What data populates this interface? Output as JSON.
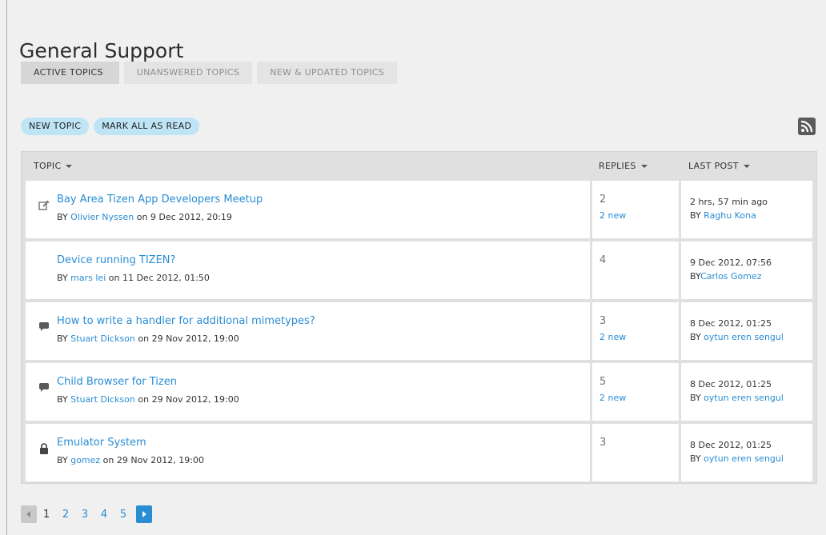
{
  "page": {
    "title": "General Support"
  },
  "tabs": [
    {
      "label": "ACTIVE TOPICS"
    },
    {
      "label": "UNANSWERED TOPICS"
    },
    {
      "label": "NEW & UPDATED TOPICS"
    }
  ],
  "actions": {
    "new_topic": "NEW TOPIC",
    "mark_all_read": "MARK ALL AS READ"
  },
  "table": {
    "headers": {
      "topic": "TOPIC",
      "replies": "REPLIES",
      "last_post": "LAST POST"
    },
    "rows": [
      {
        "icon": "edit-icon",
        "title": "Bay Area Tizen App Developers Meetup",
        "by": "BY ",
        "author": "Olivier Nyssen",
        "on": " on 9 Dec 2012,  20:19",
        "replies": "2",
        "new_replies": "2 new",
        "last_time": "2 hrs, 57 min ago",
        "last_by": "BY ",
        "last_author": "Raghu Kona"
      },
      {
        "icon": "",
        "title": "Device running TIZEN?",
        "by": "BY ",
        "author": "mars lei",
        "on": " on 11 Dec 2012,  01:50",
        "replies": "4",
        "new_replies": "",
        "last_time": "9 Dec 2012,  07:56",
        "last_by": "BY",
        "last_author": "Carlos Gomez"
      },
      {
        "icon": "chat-bubble-icon",
        "title": "How to write a handler for additional mimetypes?",
        "by": "BY ",
        "author": "Stuart Dickson",
        "on": " on 29 Nov 2012, 19:00",
        "replies": "3",
        "new_replies": "2 new",
        "last_time": "8 Dec 2012, 01:25",
        "last_by": "BY ",
        "last_author": "oytun eren sengul"
      },
      {
        "icon": "chat-bubble-icon",
        "title": "Child Browser for Tizen",
        "by": "BY ",
        "author": "Stuart Dickson",
        "on": " on 29 Nov 2012, 19:00",
        "replies": "5",
        "new_replies": "2 new",
        "last_time": "8 Dec 2012, 01:25",
        "last_by": "BY ",
        "last_author": "oytun eren sengul"
      },
      {
        "icon": "lock-icon",
        "title": "Emulator System",
        "by": "BY ",
        "author": "gomez",
        "on": " on 29 Nov 2012, 19:00",
        "replies": "3",
        "new_replies": "",
        "last_time": "8 Dec 2012, 01:25",
        "last_by": "BY ",
        "last_author": "oytun eren sengul"
      }
    ]
  },
  "pagination": {
    "pages": [
      "1",
      "2",
      "3",
      "4",
      "5"
    ],
    "current": "1"
  },
  "colors": {
    "link": "#2a8dd4",
    "pill": "#bfe4f6",
    "tab_active": "#d6d6d6",
    "table_bg": "#e0e0e0"
  }
}
